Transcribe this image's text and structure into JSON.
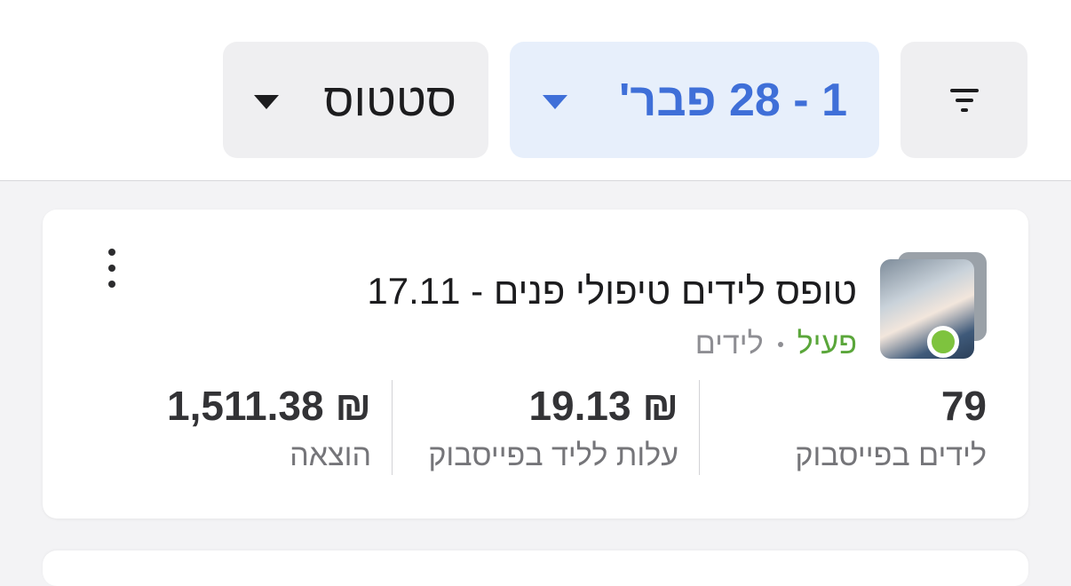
{
  "toolbar": {
    "filter_icon": "filter-icon",
    "date_range_label": "1 - 28 פבר'",
    "status_label": "סטטוס",
    "dropdown_icon": "caret-down-icon",
    "accent_color": "#3f6fd8"
  },
  "campaign": {
    "title": "טופס לידים טיפולי פנים - 17.11",
    "status": "פעיל",
    "status_color": "#7ec33e",
    "type": "לידים",
    "more_icon": "more-vertical-icon",
    "metrics": [
      {
        "value": "79",
        "label": "לידים בפייסבוק"
      },
      {
        "value": "₪ 19.13",
        "label": "עלות לליד בפייסבוק"
      },
      {
        "value": "₪ 1,511.38",
        "label": "הוצאה"
      }
    ]
  }
}
